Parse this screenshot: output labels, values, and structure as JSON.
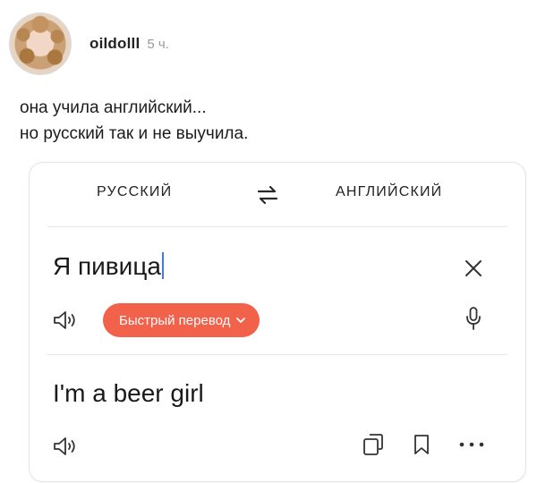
{
  "post": {
    "author": "oildolll",
    "time": "5 ч.",
    "caption_lines": [
      "она учила английский...",
      "но русский так и не выучила."
    ]
  },
  "translator": {
    "source_lang": "РУССКИЙ",
    "target_lang": "АНГЛИЙСКИЙ",
    "source_text": "Я пивица",
    "quick_translate_label": "Быстрый перевод",
    "translation": "I'm a beer girl"
  },
  "icons": {
    "avatar": "avatar",
    "swap": "swap-languages-icon",
    "clear": "close-icon",
    "speaker_source": "speaker-icon",
    "speaker_target": "speaker-icon",
    "quick_chevron": "chevron-down-icon",
    "mic": "microphone-icon",
    "copy": "copy-icon",
    "bookmark": "bookmark-icon",
    "more": "more-icon"
  },
  "colors": {
    "accent": "#f2614a",
    "caret": "#3b7cf5",
    "text": "#1a1a1a",
    "muted": "#9a9a9a"
  }
}
